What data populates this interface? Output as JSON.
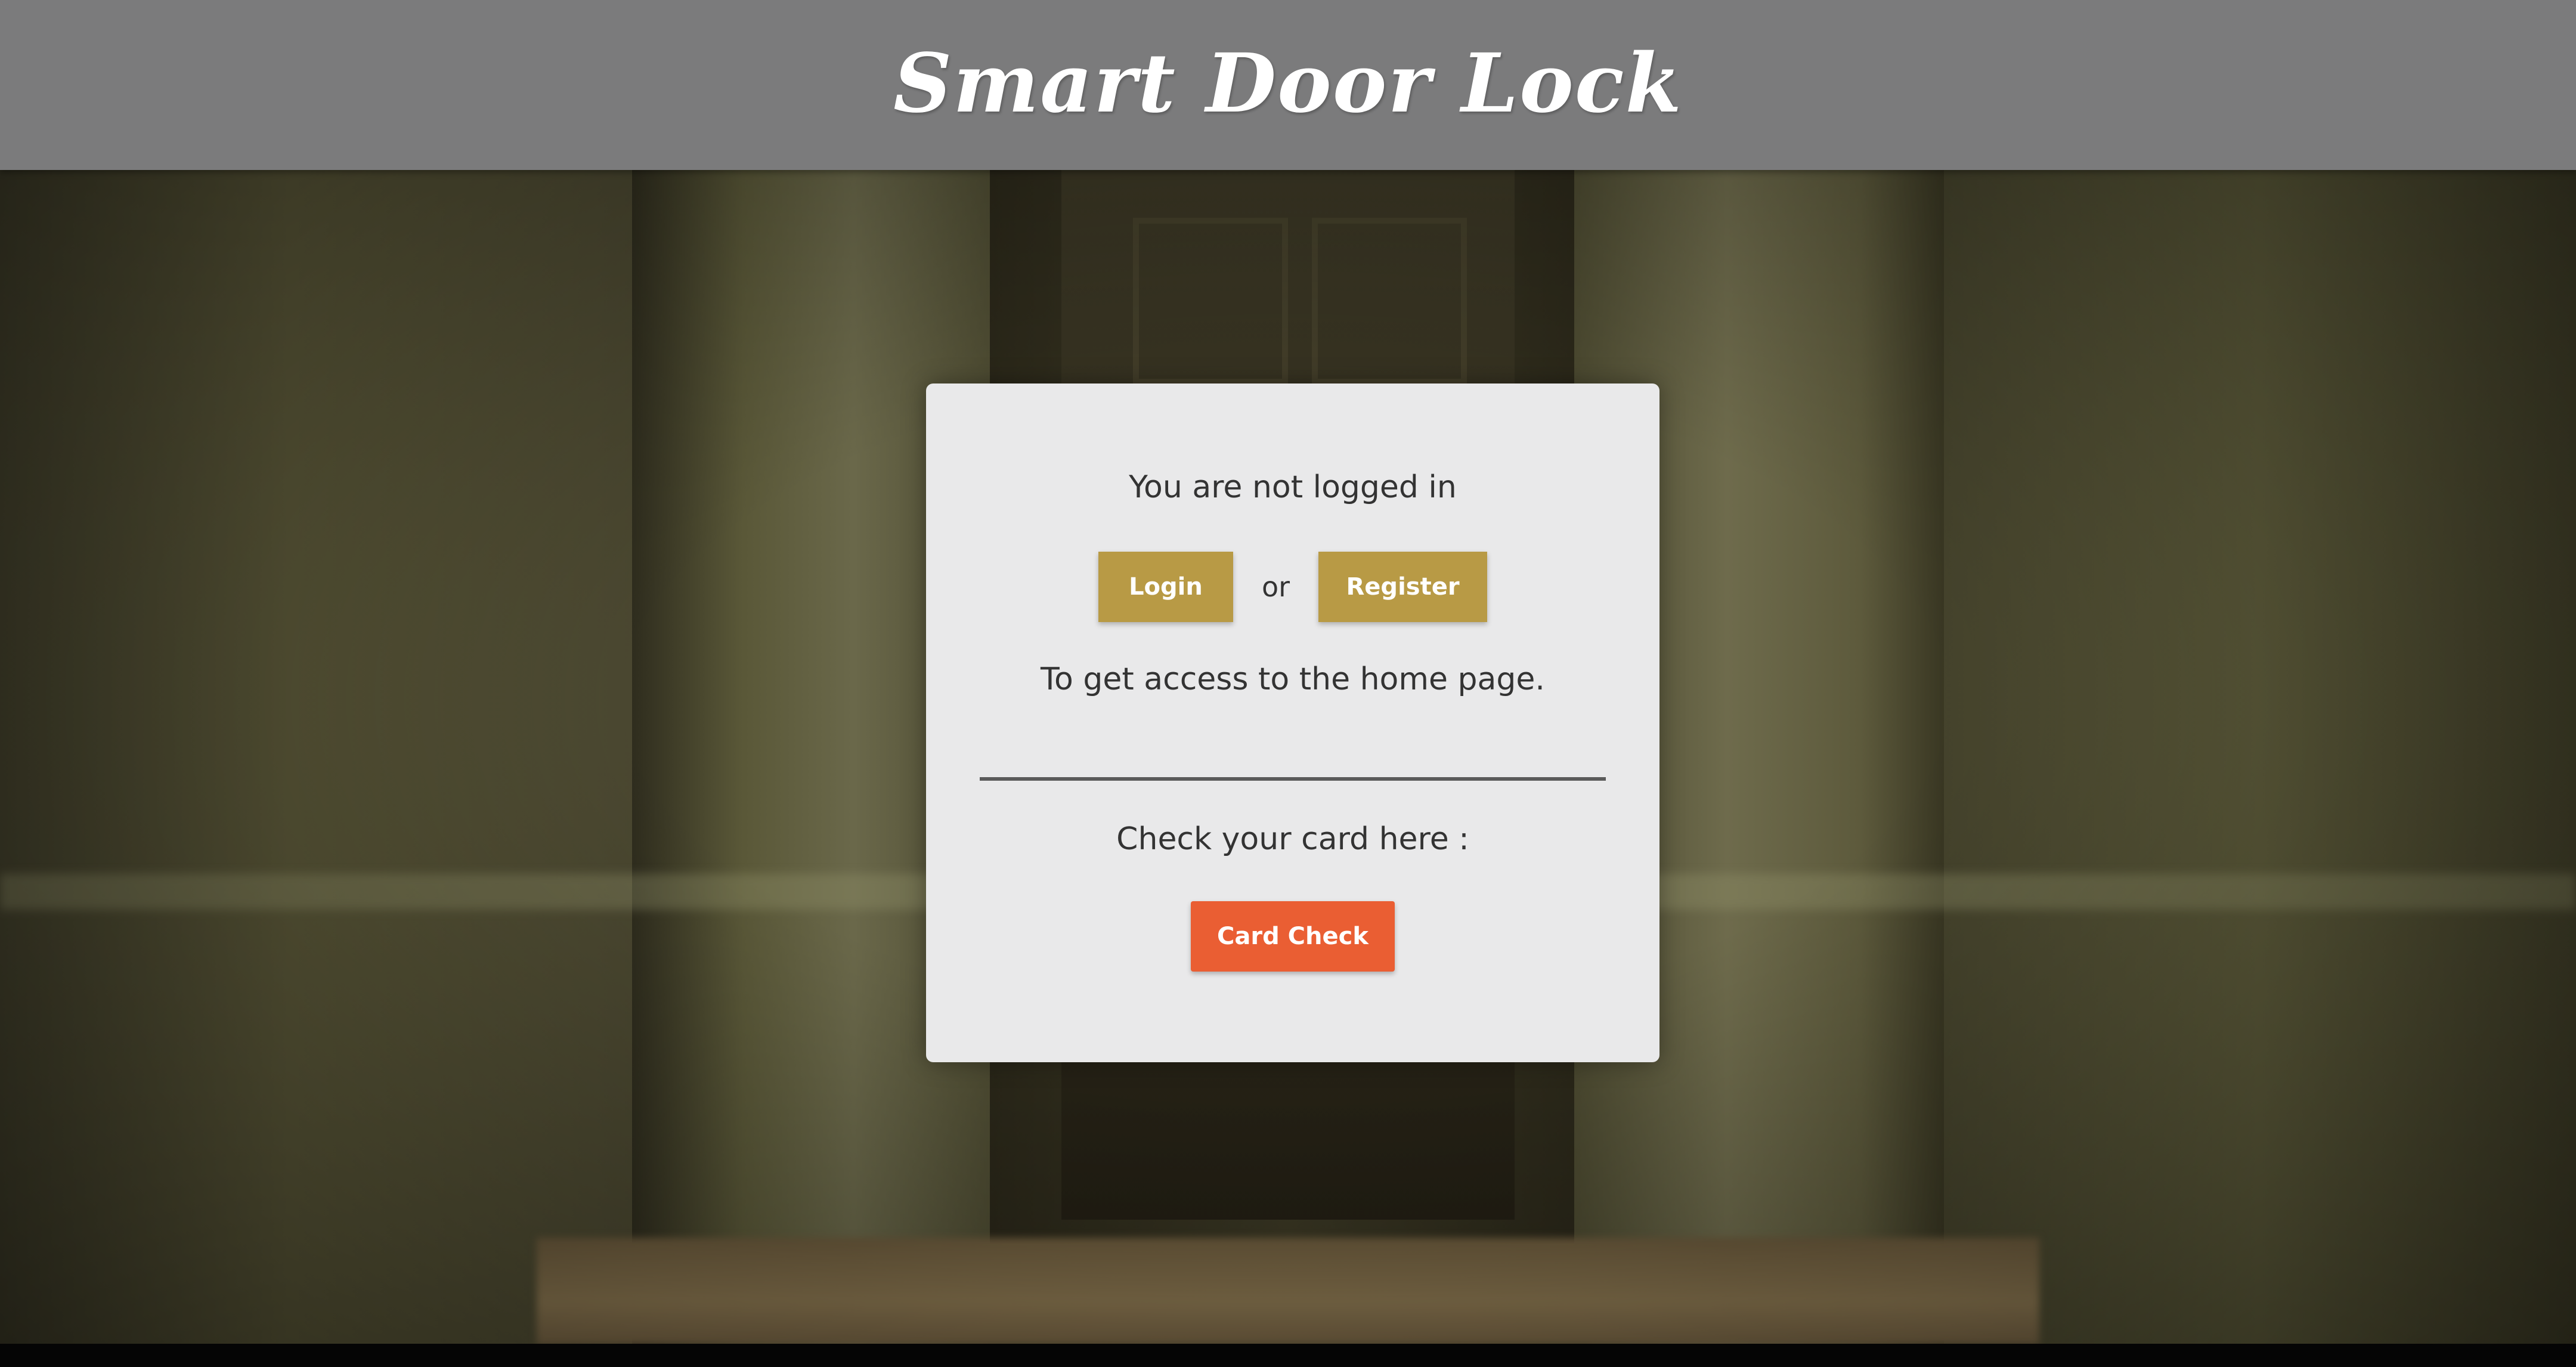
{
  "header": {
    "title": "Smart Door Lock"
  },
  "auth_card": {
    "status_text": "You are not logged in",
    "login_label": "Login",
    "or_text": "or",
    "register_label": "Register",
    "access_text": "To get access to the home page.",
    "card_prompt": "Check your card here :",
    "card_check_label": "Card Check"
  },
  "colors": {
    "header_bg": "#7b7b7c",
    "card_bg": "#e9e9ea",
    "primary_button": "#b89a45",
    "accent_button": "#ea5e33"
  }
}
